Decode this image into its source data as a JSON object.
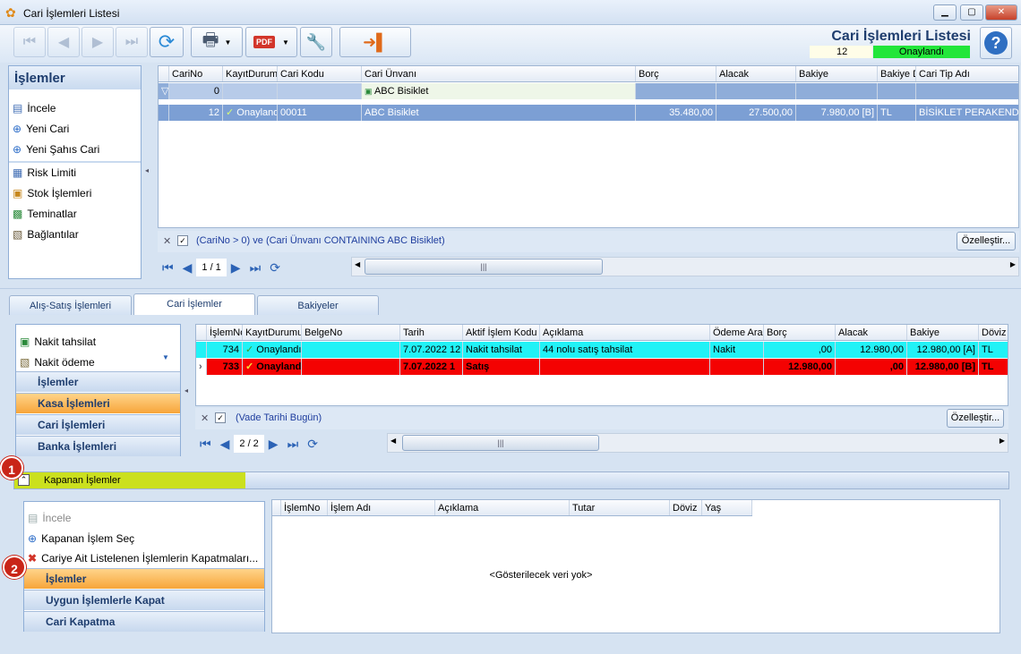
{
  "window": {
    "title": "Cari İşlemleri Listesi"
  },
  "header": {
    "title": "Cari İşlemleri Listesi",
    "count": "12",
    "status": "Onaylandı"
  },
  "left_menu": {
    "title": "İşlemler",
    "items": [
      "İncele",
      "Yeni Cari",
      "Yeni Şahıs Cari",
      "Risk Limiti",
      "Stok İşlemleri",
      "Teminatlar",
      "Bağlantılar"
    ]
  },
  "top_grid": {
    "columns": [
      "CariNo",
      "KayıtDurumu",
      "Cari Kodu",
      "Cari Ünvanı",
      "Borç",
      "Alacak",
      "Bakiye",
      "Bakiye D",
      "Cari Tip Adı"
    ],
    "filter_row": {
      "cari_no": "0",
      "unvan": "ABC Bisiklet"
    },
    "rows": [
      {
        "cari_no": "12",
        "durum": "Onaylandı",
        "kod": "00011",
        "unvan": "ABC Bisiklet",
        "borc": "35.480,00",
        "alacak": "27.500,00",
        "bakiye": "7.980,00 [B]",
        "doviz": "TL",
        "tip": "BİSİKLET PERAKENDECİ"
      }
    ],
    "filter_text": "(CariNo > 0) ve (Cari Ünvanı CONTAINING ABC Bisiklet)",
    "customize": "Özelleştir...",
    "page": "1 / 1"
  },
  "tabs": [
    "Alış-Satış İşlemleri",
    "Cari İşlemler",
    "Bakiyeler"
  ],
  "mid_menu": {
    "items": [
      "Nakit tahsilat",
      "Nakit ödeme"
    ],
    "sections": [
      "İşlemler",
      "Kasa İşlemleri",
      "Cari İşlemleri",
      "Banka İşlemleri"
    ]
  },
  "mid_grid": {
    "columns": [
      "İşlemNo",
      "KayıtDurumu",
      "BelgeNo",
      "Tarih",
      "Aktif İşlem Kodu",
      "Açıklama",
      "Ödeme Aracı",
      "Borç",
      "Alacak",
      "Bakiye",
      "Döviz"
    ],
    "rows": [
      {
        "no": "734",
        "durum": "Onaylandı",
        "belge": "",
        "tarih": "7.07.2022 12",
        "kod": "Nakit tahsilat",
        "aciklama": "44 nolu satış tahsilat",
        "odeme": "Nakit",
        "borc": ",00",
        "alacak": "12.980,00",
        "bakiye": "12.980,00 [A]",
        "doviz": "TL"
      },
      {
        "no": "733",
        "durum": "Onaylandı",
        "belge": "",
        "tarih": "7.07.2022 1",
        "kod": "Satış",
        "aciklama": "",
        "odeme": "",
        "borc": "12.980,00",
        "alacak": ",00",
        "bakiye": "12.980,00 [B]",
        "doviz": "TL"
      }
    ],
    "filter_text": "(Vade Tarihi Bugün)",
    "customize": "Özelleştir...",
    "page": "2 / 2"
  },
  "closed": {
    "title": "Kapanan İşlemler",
    "items": [
      "İncele",
      "Kapanan İşlem Seç",
      "Cariye Ait Listelenen İşlemlerin Kapatmaları..."
    ],
    "sections": [
      "İşlemler",
      "Uygun İşlemlerle Kapat",
      "Cari Kapatma"
    ],
    "columns": [
      "İşlemNo",
      "İşlem Adı",
      "Açıklama",
      "Tutar",
      "Döviz",
      "Yaş"
    ],
    "empty": "<Gösterilecek veri yok>"
  },
  "badges": [
    "1",
    "2"
  ],
  "colors": {
    "cyan_row": "#21f2f6",
    "red_row": "#f40202",
    "status_green": "#22e63a",
    "accent_orange": "#f7a53a",
    "highlight_yellow": "#cbe01e"
  }
}
